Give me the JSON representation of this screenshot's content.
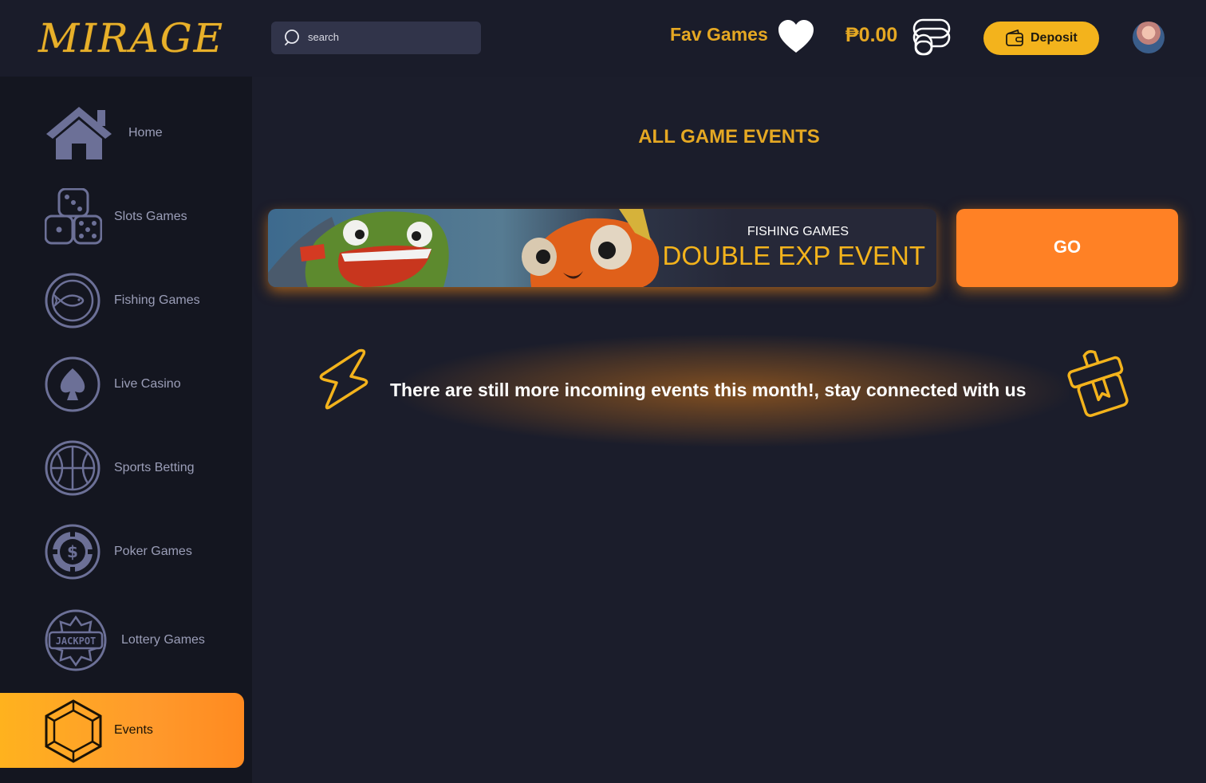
{
  "brand": {
    "logo_text": "MIRAGE"
  },
  "header": {
    "search_placeholder": "search",
    "fav_label": "Fav Games",
    "balance": "₱0.00",
    "deposit_label": "Deposit"
  },
  "sidebar": {
    "items": [
      {
        "label": "Home",
        "icon": "home-icon"
      },
      {
        "label": "Slots Games",
        "icon": "dice-icon"
      },
      {
        "label": "Fishing Games",
        "icon": "fish-icon"
      },
      {
        "label": "Live Casino",
        "icon": "spade-icon"
      },
      {
        "label": "Sports Betting",
        "icon": "basketball-icon"
      },
      {
        "label": "Poker Games",
        "icon": "poker-chip-icon"
      },
      {
        "label": "Lottery Games",
        "icon": "jackpot-icon",
        "badge_text": "JACKPOT"
      },
      {
        "label": "Events",
        "icon": "gem-icon",
        "active": true
      }
    ]
  },
  "main": {
    "title": "ALL GAME EVENTS",
    "event": {
      "category": "FISHING GAMES",
      "headline": "DOUBLE EXP EVENT",
      "action_label": "GO"
    },
    "message": "There are still more incoming events this month!, stay connected with us"
  },
  "colors": {
    "accent": "#e5a823",
    "go_button": "#ff8125",
    "active_nav": "#ffb21e",
    "background": "#1b1d2b",
    "sidebar": "#141620"
  }
}
